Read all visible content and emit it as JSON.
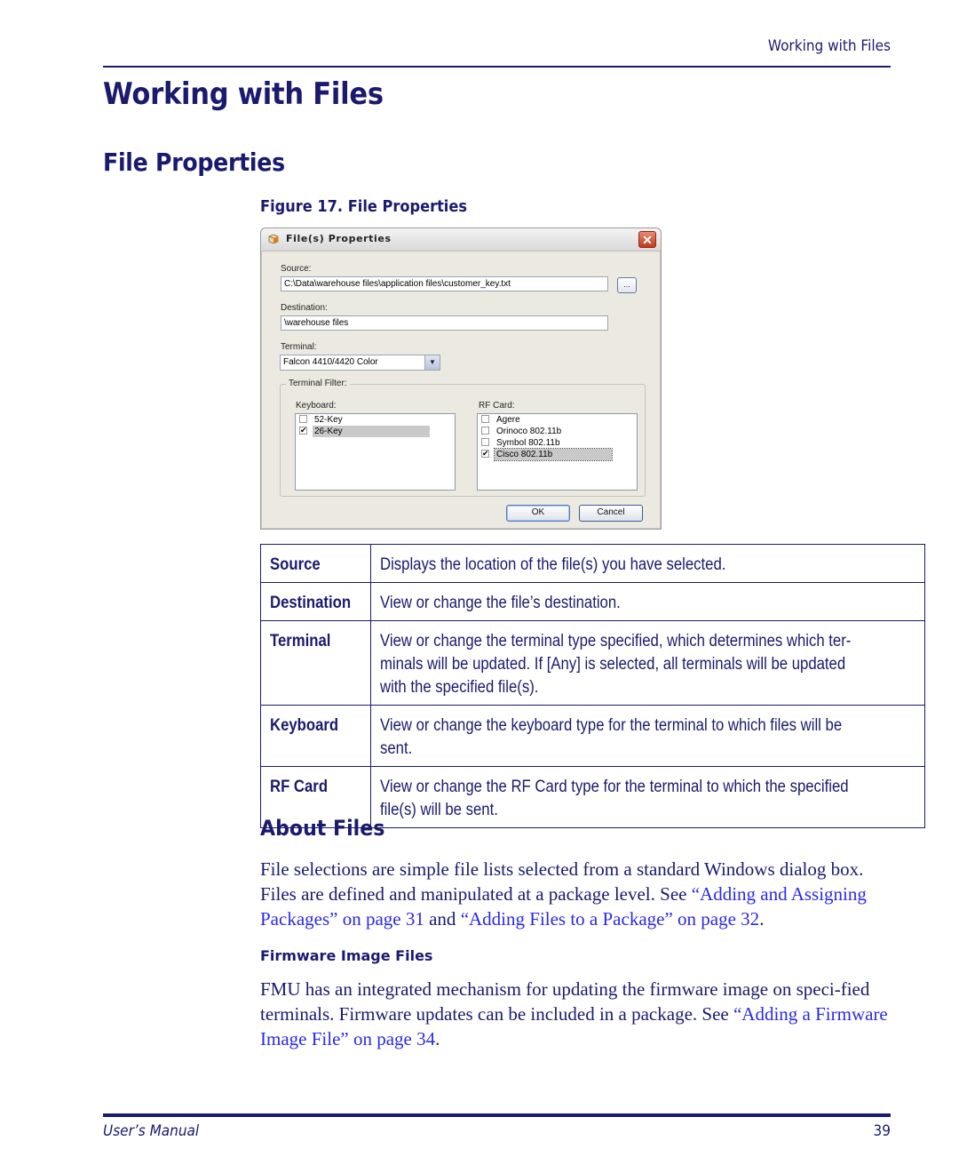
{
  "header": {
    "running_title": "Working with Files"
  },
  "headings": {
    "chapter": "Working with Files",
    "section": "File Properties",
    "figure_caption": "Figure 17. File Properties",
    "about": "About Files",
    "firmware": "Firmware Image Files"
  },
  "dialog": {
    "title": "File(s) Properties",
    "close_icon": "close-icon",
    "source_label": "Source:",
    "source_value": "C:\\Data\\warehouse files\\application files\\customer_key.txt",
    "browse_label": "...",
    "destination_label": "Destination:",
    "destination_value": "\\warehouse files",
    "terminal_label": "Terminal:",
    "terminal_value": "Falcon 4410/4420 Color",
    "filter_label": "Terminal Filter:",
    "keyboard_label": "Keyboard:",
    "keyboard_items": [
      {
        "label": "52-Key",
        "checked": false
      },
      {
        "label": "26-Key",
        "checked": true
      }
    ],
    "rfcard_label": "RF Card:",
    "rfcard_items": [
      {
        "label": "Agere",
        "checked": false
      },
      {
        "label": "Orinoco 802.11b",
        "checked": false
      },
      {
        "label": "Symbol 802.11b",
        "checked": false
      },
      {
        "label": "Cisco 802.11b",
        "checked": true
      }
    ],
    "ok_label": "OK",
    "cancel_label": "Cancel"
  },
  "definitions": [
    {
      "term": "Source",
      "lines": [
        "Displays the location of the file(s) you have selected."
      ]
    },
    {
      "term": "Destination",
      "lines": [
        "View or change the file’s destination."
      ]
    },
    {
      "term": "Terminal",
      "lines": [
        "View or change the terminal type specified, which determines which ter-",
        "minals will be updated. If [Any] is selected, all terminals will be updated",
        "with the specified file(s)."
      ]
    },
    {
      "term": "Keyboard",
      "lines": [
        "View or change the keyboard type for the terminal to which files will be",
        "sent."
      ]
    },
    {
      "term": "RF Card",
      "lines": [
        "View or change the RF Card type for the terminal to which the specified",
        "file(s) will be sent."
      ]
    }
  ],
  "about_para": {
    "text1": "File selections are simple file lists selected from a standard Windows dialog box. Files are defined and manipulated at a package level. See ",
    "link1": "“Adding and Assigning Packages” on page 31",
    "text2": " and ",
    "link2": "“Adding Files to a Package” on page 32",
    "text3": "."
  },
  "firmware_para": {
    "text1": "FMU has an integrated mechanism for updating the firmware image on speci-fied terminals. Firmware updates can be included in a package. See ",
    "link1": "“Adding a Firmware Image File” on page 34",
    "text2": "."
  },
  "footer": {
    "left": "User’s Manual",
    "page": "39"
  },
  "colors": {
    "text_navy": "#1a1a6e",
    "link_blue": "#2a2ae6"
  }
}
